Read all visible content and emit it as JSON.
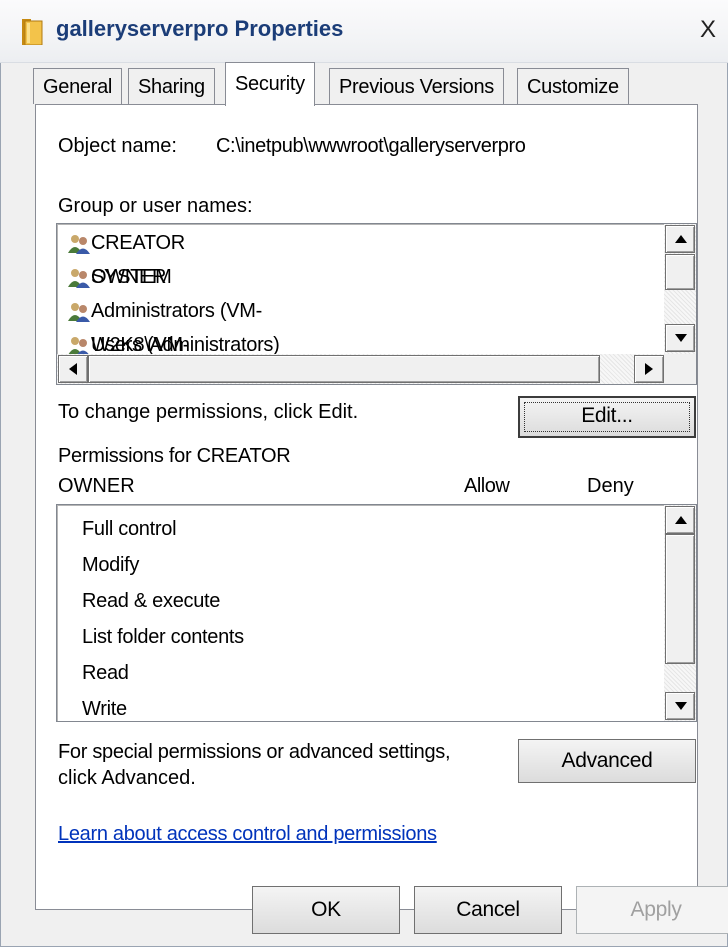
{
  "window": {
    "title": "galleryserverpro Properties",
    "close_glyph": "X"
  },
  "tabs": [
    {
      "label": "General",
      "active": false
    },
    {
      "label": "Sharing",
      "active": false
    },
    {
      "label": "Security",
      "active": true
    },
    {
      "label": "Previous Versions",
      "active": false
    },
    {
      "label": "Customize",
      "active": false
    }
  ],
  "security": {
    "object_name_label": "Object name:",
    "object_name_value": "C:\\inetpub\\wwwroot\\galleryserverpro",
    "groups_label": "Group or user names:",
    "groups": [
      {
        "name": "CREATOR OWNER",
        "icon": "users-group-icon",
        "selected": true
      },
      {
        "name": "SYSTEM",
        "icon": "users-group-icon",
        "selected": false
      },
      {
        "name": "Administrators (VM-W2K8\\Administrators)",
        "icon": "users-group-icon",
        "selected": false
      },
      {
        "name": "Users (VM-W2K8\\Users)",
        "icon": "users-group-icon",
        "selected": false
      }
    ],
    "change_hint": "To change permissions, click Edit.",
    "edit_button": "Edit...",
    "permissions_for_line1": "Permissions for CREATOR",
    "permissions_for_line2": "OWNER",
    "allow_header": "Allow",
    "deny_header": "Deny",
    "permissions": [
      "Full control",
      "Modify",
      "Read & execute",
      "List folder contents",
      "Read",
      "Write"
    ],
    "special_line1": "For special permissions or advanced settings,",
    "special_line2": "click Advanced.",
    "advanced_button": "Advanced",
    "learn_link": "Learn about access control and permissions"
  },
  "footer": {
    "ok": "OK",
    "cancel": "Cancel",
    "apply": "Apply"
  },
  "colors": {
    "title_text": "#1b3d78",
    "link": "#0033bb",
    "panel_bg": "#ffffff",
    "window_bg": "#f0f0f0"
  }
}
